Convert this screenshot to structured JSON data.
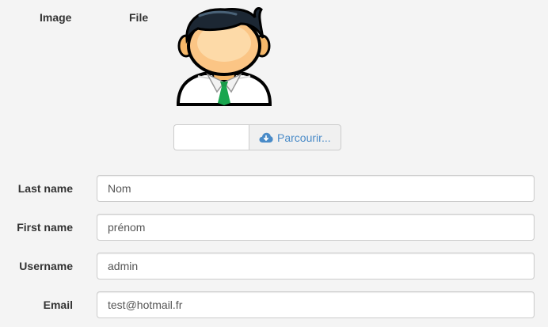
{
  "headers": {
    "image": "Image",
    "file": "File"
  },
  "avatar": {
    "icon": "user-avatar-icon"
  },
  "file_upload": {
    "selected_file": "",
    "browse_label": "Parcourir...",
    "browse_icon": "cloud-download-icon"
  },
  "form": {
    "last_name": {
      "label": "Last name",
      "value": "Nom"
    },
    "first_name": {
      "label": "First name",
      "value": "prénom"
    },
    "username": {
      "label": "Username",
      "value": "admin"
    },
    "email": {
      "label": "Email",
      "value": "test@hotmail.fr"
    }
  },
  "colors": {
    "background": "#f4f4f4",
    "link_blue": "#4a8bc8",
    "border": "#cccccc"
  }
}
